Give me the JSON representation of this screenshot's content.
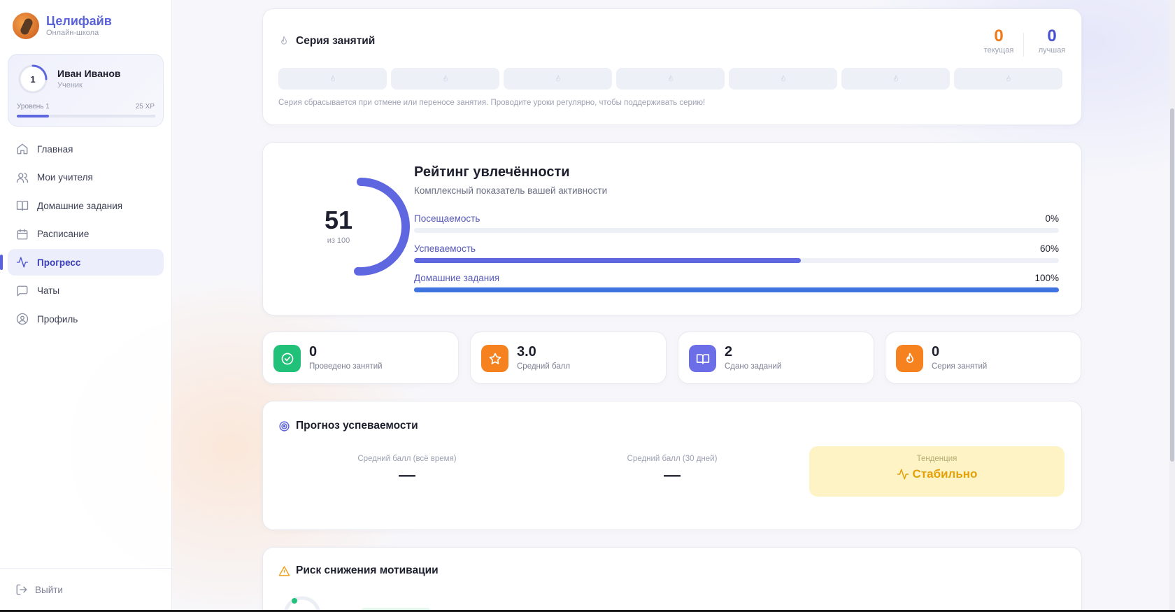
{
  "brand": {
    "name": "Целифайв",
    "subtitle": "Онлайн-школа"
  },
  "user": {
    "name": "Иван Иванов",
    "role": "Ученик",
    "level_number": "1",
    "level_label": "Уровень 1",
    "xp_label": "25 XP",
    "xp_progress": 0.23
  },
  "nav": {
    "items": [
      {
        "label": "Главная",
        "icon": "home-icon"
      },
      {
        "label": "Мои учителя",
        "icon": "users-icon"
      },
      {
        "label": "Домашние задания",
        "icon": "book-icon"
      },
      {
        "label": "Расписание",
        "icon": "calendar-icon"
      },
      {
        "label": "Прогресс",
        "icon": "activity-icon",
        "active": true
      },
      {
        "label": "Чаты",
        "icon": "chat-icon"
      },
      {
        "label": "Профиль",
        "icon": "user-circle-icon"
      }
    ],
    "logout_label": "Выйти"
  },
  "streak": {
    "title": "Серия занятий",
    "current_value": "0",
    "current_label": "текущая",
    "best_value": "0",
    "best_label": "лучшая",
    "days_count": 7,
    "note": "Серия сбрасывается при отмене или переносе занятия. Проводите уроки регулярно, чтобы поддерживать серию!",
    "current_color": "#f07a1a",
    "best_color": "#4a50d0"
  },
  "engagement": {
    "score": "51",
    "score_value": 51,
    "score_sub": "из 100",
    "title": "Рейтинг увлечённости",
    "subtitle": "Комплексный показатель вашей активности",
    "metrics": [
      {
        "label": "Посещаемость",
        "pct": "0%",
        "value": 0,
        "color": "#5f67e0"
      },
      {
        "label": "Успеваемость",
        "pct": "60%",
        "value": 60,
        "color": "#5f67e0"
      },
      {
        "label": "Домашние задания",
        "pct": "100%",
        "value": 100,
        "color": "#3f73e0"
      }
    ],
    "gauge_color": "#5f67e0"
  },
  "stats": [
    {
      "value": "0",
      "label": "Проведено занятий",
      "icon": "check-circle-icon",
      "color": "#22c17a"
    },
    {
      "value": "3.0",
      "label": "Средний балл",
      "icon": "star-icon",
      "color": "#f5811f"
    },
    {
      "value": "2",
      "label": "Сдано заданий",
      "icon": "book-open-icon",
      "color": "#6b6ee6"
    },
    {
      "value": "0",
      "label": "Серия занятий",
      "icon": "flame-icon",
      "color": "#f5811f"
    }
  ],
  "forecast": {
    "title": "Прогноз успеваемости",
    "avg_all_label": "Средний балл (всё время)",
    "avg_all_value": "—",
    "avg_30_label": "Средний балл (30 дней)",
    "avg_30_value": "—",
    "trend_label": "Тенденция",
    "trend_value": "Стабильно"
  },
  "risk": {
    "title": "Риск снижения мотивации"
  }
}
